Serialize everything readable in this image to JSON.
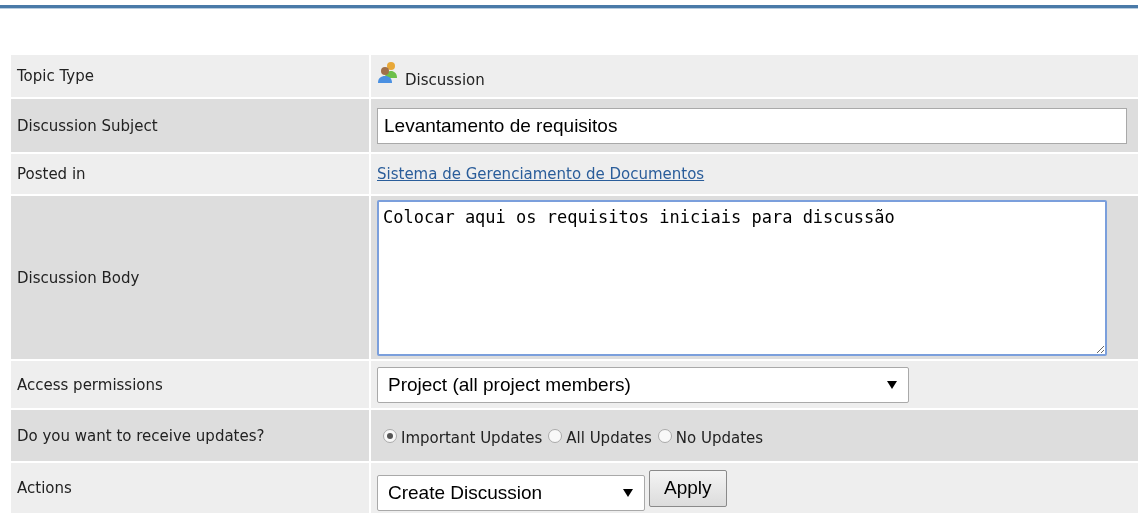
{
  "form": {
    "rows": [
      {
        "kind": "type",
        "label": "Topic Type",
        "value": "Discussion"
      },
      {
        "kind": "input",
        "label": "Discussion Subject",
        "value": "Levantamento de requisitos"
      },
      {
        "kind": "link",
        "label": "Posted in",
        "value": "Sistema de Gerenciamento de Documentos"
      },
      {
        "kind": "textarea",
        "label": "Discussion Body",
        "value": "Colocar aqui os requisitos iniciais para discussão"
      },
      {
        "kind": "select",
        "label": "Access permissions",
        "value": "Project (all project members)"
      },
      {
        "kind": "radios",
        "label": "Do you want to receive updates?",
        "options": [
          {
            "label": "Important Updates",
            "selected": true
          },
          {
            "label": "All Updates",
            "selected": false
          },
          {
            "label": "No Updates",
            "selected": false
          }
        ]
      },
      {
        "kind": "actions",
        "label": "Actions",
        "value": "Create Discussion",
        "button": "Apply"
      }
    ]
  }
}
